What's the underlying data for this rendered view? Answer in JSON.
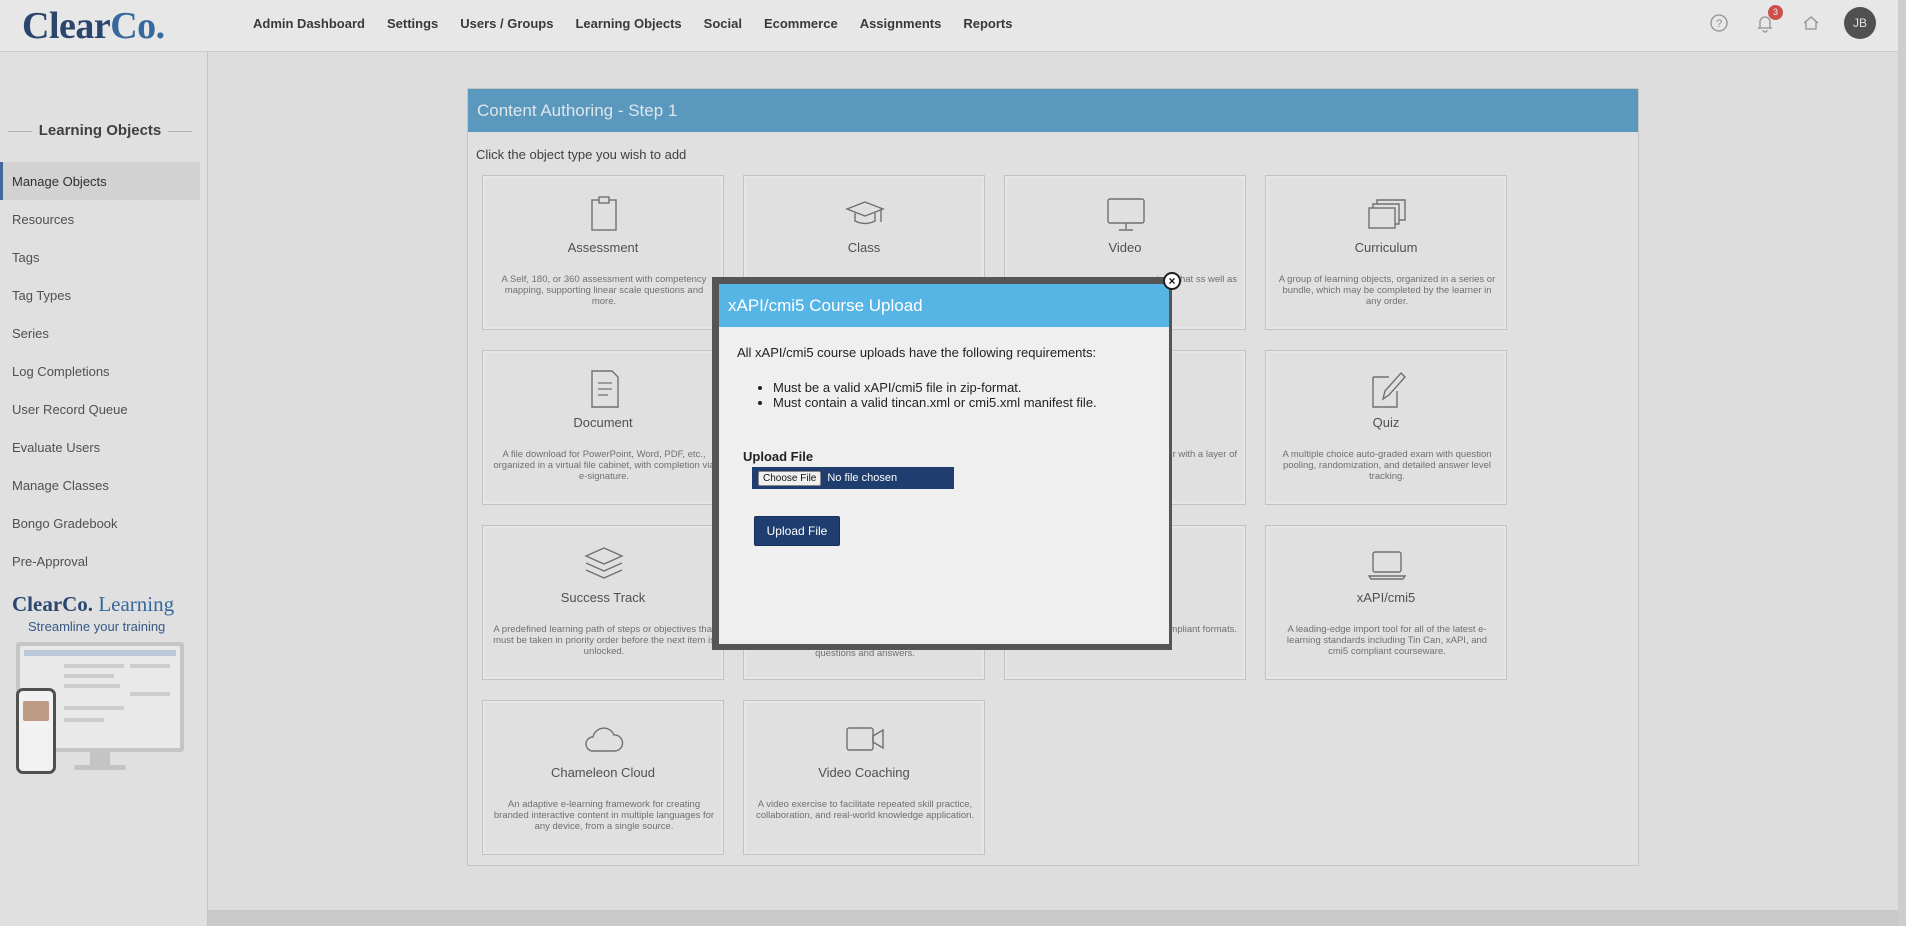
{
  "logo": {
    "brand": "Clear",
    "brand_accent": "Co."
  },
  "nav": [
    "Admin Dashboard",
    "Settings",
    "Users / Groups",
    "Learning Objects",
    "Social",
    "Ecommerce",
    "Assignments",
    "Reports"
  ],
  "header_icons": {
    "help": "help-icon",
    "notifications": "bell-icon",
    "home": "home-icon",
    "notification_count": "3",
    "avatar_initials": "JB"
  },
  "sidebar": {
    "title": "Learning Objects",
    "items": [
      "Manage Objects",
      "Resources",
      "Tags",
      "Tag Types",
      "Series",
      "Log Completions",
      "User Record Queue",
      "Evaluate Users",
      "Manage Classes",
      "Bongo Gradebook",
      "Pre-Approval"
    ],
    "active_index": 0,
    "promo": {
      "brand": "ClearCo.",
      "brand_suffix": "Learning",
      "tagline": "Streamline your training"
    }
  },
  "panel": {
    "title": "Content Authoring - Step 1",
    "instruction": "Click the object type you wish to add",
    "tiles": [
      {
        "name": "Assessment",
        "icon": "clipboard-icon",
        "desc": "A Self, 180, or 360 assessment with competency mapping, supporting linear scale questions and more."
      },
      {
        "name": "Class",
        "icon": "graduation-cap-icon",
        "desc": ""
      },
      {
        "name": "Video",
        "icon": "monitor-icon",
        "desc": "steps that ss well as"
      },
      {
        "name": "Curriculum",
        "icon": "stacked-windows-icon",
        "desc": "A group of learning objects, organized in a series or bundle, which may be completed by the learner in any order."
      },
      {
        "name": "Document",
        "icon": "document-icon",
        "desc": "A file download for PowerPoint, Word, PDF, etc., organized in a virtual file cabinet, with completion via e-signature."
      },
      {
        "name": "",
        "icon": "",
        "desc": ""
      },
      {
        "name": "",
        "icon": "",
        "desc": "net URL's or with a layer of"
      },
      {
        "name": "Quiz",
        "icon": "pencil-note-icon",
        "desc": "A multiple choice auto-graded exam with question pooling, randomization, and detailed answer level tracking."
      },
      {
        "name": "Success Track",
        "icon": "layers-icon",
        "desc": "A predefined learning path of steps or objectives that must be taken in priority order before the next item is unlocked."
      },
      {
        "name": "",
        "icon": "",
        "desc": "questions and answers."
      },
      {
        "name": "",
        "icon": "",
        "desc": "try standard ORM or AICC compliant formats."
      },
      {
        "name": "xAPI/cmi5",
        "icon": "laptop-icon",
        "desc": "A leading-edge import tool for all of the latest e-learning standards including Tin Can, xAPI, and cmi5 compliant courseware."
      },
      {
        "name": "Chameleon Cloud",
        "icon": "cloud-icon",
        "desc": "An adaptive e-learning framework for creating branded interactive content in multiple languages for any device, from a single source."
      },
      {
        "name": "Video Coaching",
        "icon": "video-camera-icon",
        "desc": "A video exercise to facilitate repeated skill practice, collaboration, and real-world knowledge application."
      }
    ]
  },
  "modal": {
    "title": "xAPI/cmi5 Course Upload",
    "intro": "All xAPI/cmi5 course uploads have the following requirements:",
    "requirements": [
      "Must be a valid xAPI/cmi5 file in zip-format.",
      "Must contain a valid tincan.xml or cmi5.xml manifest file."
    ],
    "upload_label": "Upload File",
    "choose_file_label": "Choose File",
    "file_status": "No file chosen",
    "upload_button": "Upload File",
    "close_glyph": "×"
  }
}
